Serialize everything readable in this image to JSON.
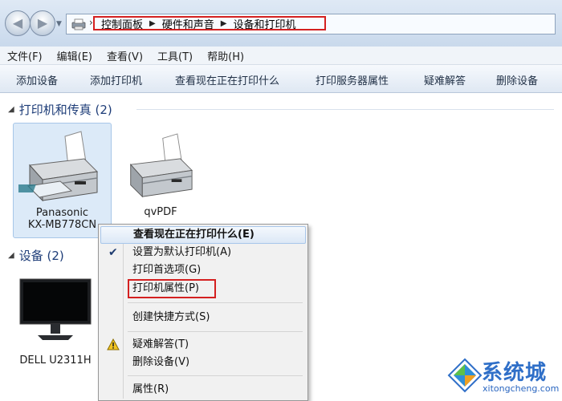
{
  "address": {
    "crumbs": [
      "控制面板",
      "硬件和声音",
      "设备和打印机"
    ]
  },
  "menu": [
    "文件(F)",
    "编辑(E)",
    "查看(V)",
    "工具(T)",
    "帮助(H)"
  ],
  "commands": [
    "添加设备",
    "添加打印机",
    "查看现在正在打印什么",
    "打印服务器属性",
    "疑难解答",
    "删除设备"
  ],
  "groups": {
    "printers_header": "打印机和传真 (2)",
    "devices_header": "设备 (2)"
  },
  "printers": [
    {
      "line1": "Panasonic",
      "line2": "KX-MB778CN"
    },
    {
      "line1": "qvPDF"
    }
  ],
  "devices": [
    {
      "label": "DELL U2311H"
    }
  ],
  "context_menu": {
    "items": [
      "查看现在正在打印什么(E)",
      "设置为默认打印机(A)",
      "打印首选项(G)",
      "打印机属性(P)",
      "创建快捷方式(S)",
      "疑难解答(T)",
      "删除设备(V)",
      "属性(R)"
    ]
  },
  "watermark": {
    "brand": "系统城",
    "url": "xitongcheng.com"
  },
  "colors": {
    "highlight_box": "#d42020",
    "accent": "#1e3d78"
  }
}
